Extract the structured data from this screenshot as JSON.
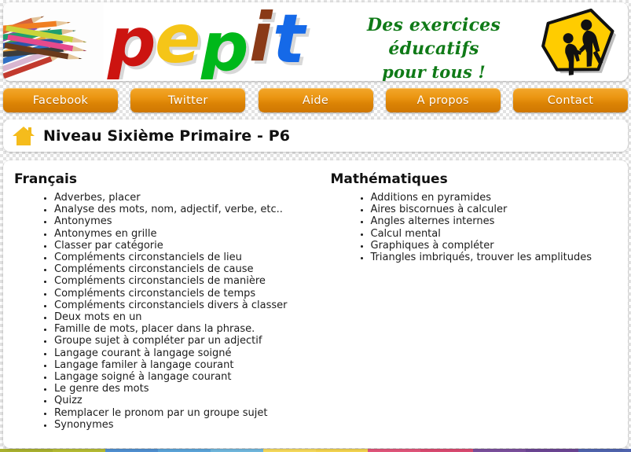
{
  "site": {
    "logo_text": "pepit",
    "logo_letters": [
      {
        "char": "p",
        "color": "#cc1410"
      },
      {
        "char": "e",
        "color": "#f5c518"
      },
      {
        "char": "p",
        "color": "#00b81a"
      },
      {
        "char": "i",
        "color": "#8a3a17"
      },
      {
        "char": "t",
        "color": "#1569e8"
      }
    ],
    "tagline_line1": "Des exercices éducatifs",
    "tagline_line2": "pour tous !",
    "tagline_color": "#0f7a17",
    "pencils_image_alt": "colored-pencils-photo",
    "school_sign_alt": "school-crossing-sign"
  },
  "nav": {
    "items": [
      {
        "label": "Facebook",
        "name": "nav-facebook"
      },
      {
        "label": "Twitter",
        "name": "nav-twitter"
      },
      {
        "label": "Aide",
        "name": "nav-aide"
      },
      {
        "label": "A propos",
        "name": "nav-a-propos"
      },
      {
        "label": "Contact",
        "name": "nav-contact"
      }
    ],
    "button_color_top": "#f3a72b",
    "button_color_bottom": "#cf7702",
    "button_text_color": "#ffffff"
  },
  "header": {
    "title": "Niveau Sixième Primaire - P6",
    "home_icon": "home-icon",
    "home_icon_color": "#f5bc1c"
  },
  "main": {
    "columns": [
      {
        "heading": "Français",
        "items": [
          "Adverbes, placer",
          "Analyse des mots, nom, adjectif, verbe, etc..",
          "Antonymes",
          "Antonymes en grille",
          "Classer par catégorie",
          "Compléments circonstanciels de lieu",
          "Compléments circonstanciels de cause",
          "Compléments circonstanciels de manière",
          "Compléments circonstanciels de temps",
          "Compléments circonstanciels divers à classer",
          "Deux mots en un",
          "Famille de mots, placer dans la phrase.",
          "Groupe sujet à compléter par un adjectif",
          "Langage courant à langage soigné",
          "Langage familer à langage courant",
          "Langage soigné à langage courant",
          "Le genre des mots",
          "Quizz",
          "Remplacer le pronom par un groupe sujet",
          "Synonymes"
        ]
      },
      {
        "heading": "Mathématiques",
        "items": [
          "Additions en pyramides",
          "Aires biscornues à calculer",
          "Angles alternes internes",
          "Calcul mental",
          "Graphiques à compléter",
          "Triangles imbriqués, trouver les amplitudes"
        ]
      }
    ]
  },
  "footer_strip": {
    "colors": [
      "#a8b02e",
      "#b4bb33",
      "#4f8fd0",
      "#5aa3d8",
      "#6fb7dd",
      "#f5d85a",
      "#f2d24e",
      "#e0557a",
      "#d94a70",
      "#7a4f9c",
      "#6b4593",
      "#4f63ad"
    ]
  }
}
